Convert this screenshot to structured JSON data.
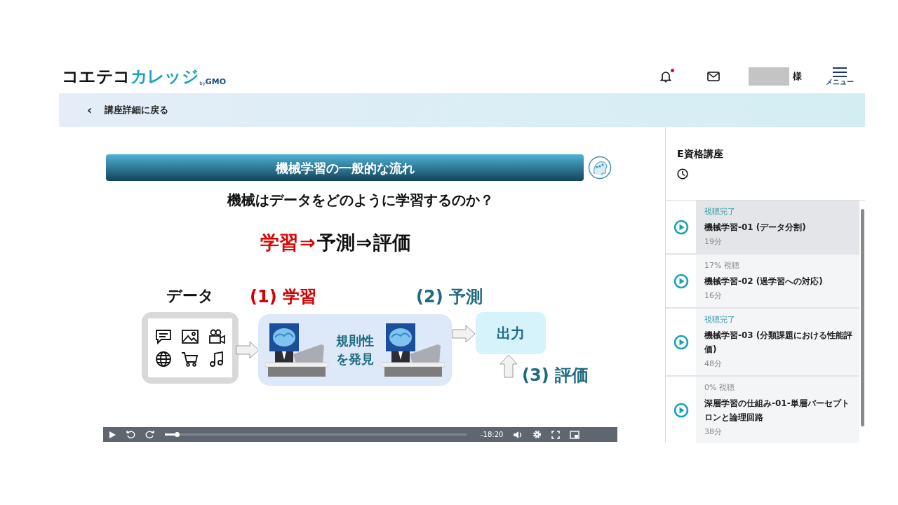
{
  "header": {
    "logo": {
      "main": "コエテコ",
      "accent": "カレッジ",
      "by": "by",
      "brand": "GMO"
    },
    "notifications": {
      "unread": true
    },
    "user_suffix": "様",
    "menu_label": "メニュー"
  },
  "back_link": {
    "icon": "‹",
    "label": "講座詳細に戻る"
  },
  "slide": {
    "title": "機械学習の一般的な流れ",
    "question": "機械はデータをどのように学習するのか？",
    "flow": [
      {
        "text": "学習",
        "highlight": true
      },
      {
        "text": "⇒",
        "highlight": true
      },
      {
        "text": "予測",
        "highlight": false
      },
      {
        "text": "⇒",
        "highlight": false
      },
      {
        "text": "評価",
        "highlight": false
      }
    ],
    "data_label": "データ",
    "steps": [
      {
        "label": "(1) 学習",
        "color": "#d40000"
      },
      {
        "label": "(2) 予測",
        "color": "#1f6a80"
      },
      {
        "label": "(3) 評価",
        "color": "#1f6a80"
      }
    ],
    "process_text": [
      "規則性",
      "を発見"
    ],
    "output_label": "出力"
  },
  "player": {
    "level": 0.04,
    "time": "-18:20"
  },
  "course": {
    "title": "E資格講座",
    "lessons": [
      {
        "status": "視聴完了",
        "completed": true,
        "title": "機械学習-01 (データ分割)",
        "duration": "19分",
        "selected": true
      },
      {
        "status": "17% 視聴",
        "completed": false,
        "title": "機械学習-02 (過学習への対応)",
        "duration": "16分",
        "selected": false
      },
      {
        "status": "視聴完了",
        "completed": true,
        "title": "機械学習-03 (分類課題における性能評価)",
        "duration": "48分",
        "selected": false
      },
      {
        "status": "0% 視聴",
        "completed": false,
        "title": "深層学習の仕組み-01-単層パーセプトロンと論理回路",
        "duration": "38分",
        "selected": false
      }
    ]
  }
}
